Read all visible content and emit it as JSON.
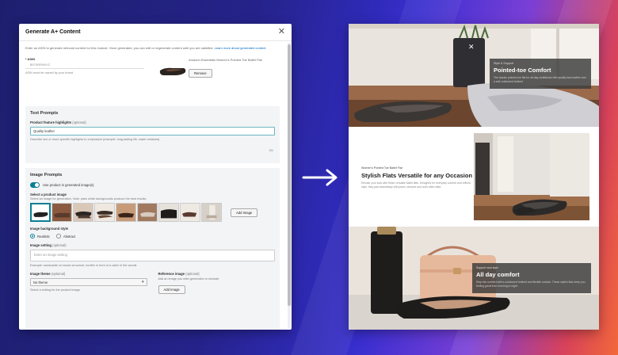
{
  "modal": {
    "title": "Generate A+ Content",
    "intro_text": "Enter an ASIN to generate relevant content for this module. Once generated, you can edit or regenerate content until you are satisfied.",
    "intro_link": "Learn more about generated content",
    "asin": {
      "label": "* ASIN",
      "value": "B07XRFMXYZ",
      "note": "ASIN must be owned by your brand"
    },
    "product": {
      "name": "Amazon Essentials Women's Pointed Toe Ballet Flat",
      "remove_label": "Remove"
    },
    "text_prompts": {
      "title": "Text Prompts",
      "field_label": "Product feature highlights",
      "field_optional": "(optional)",
      "field_value": "Quality leather",
      "hint": "Describe one or more specific highlights to emphasize (example: long-lasting life, water resistant)",
      "counter": "0/1"
    },
    "image_prompts": {
      "title": "Image Prompts",
      "toggle_label": "Use product in generated image(s)",
      "select_label": "Select a product image",
      "select_hint": "Select an image for generation. Note: plain white backgrounds produce the best results.",
      "add_image_label": "Add Image",
      "bg_style_label": "Image background style",
      "bg_options": [
        "Realistic",
        "Abstract"
      ],
      "setting_label": "Image setting",
      "setting_optional": "(optional)",
      "setting_placeholder": "Enter an image setting",
      "setting_hint": "Example: sandcastle on beach at sunset, bonfire in front of a cabin in the woods",
      "theme_label": "Image theme",
      "theme_optional": "(optional)",
      "theme_value": "No theme",
      "theme_hint": "Select a setting for the product image",
      "reference_label": "Reference image",
      "reference_optional": "(optional)",
      "reference_hint": "Add an image you wish generation to emulate",
      "reference_button": "Add Image"
    }
  },
  "preview": {
    "panel1": {
      "kicker": "Style & Support",
      "title": "Pointed-toe Comfort",
      "body": "The classic pointed-toe flat for all-day confidence with quality faux leather and a soft cushioned footbed"
    },
    "panel2": {
      "kicker": "Women's Pointed Toe Ballet Flat",
      "title": "Stylish Flats Versatile for any Occasion",
      "body": "Elevate your look with these versatile ballet flats. Designed for everyday comfort and refined style, they pair seamlessly with jeans, dresses and work attire alike."
    },
    "panel3": {
      "kicker": "Support and style",
      "title": "All day comfort",
      "body": "Step into comfort with a cushioned footbed and flexible outsole. These stylish flats keep you feeling great from morning to night."
    }
  },
  "colors": {
    "accent": "#0a7f94",
    "link": "#0066c0",
    "overlay": "#3a3a3a"
  }
}
